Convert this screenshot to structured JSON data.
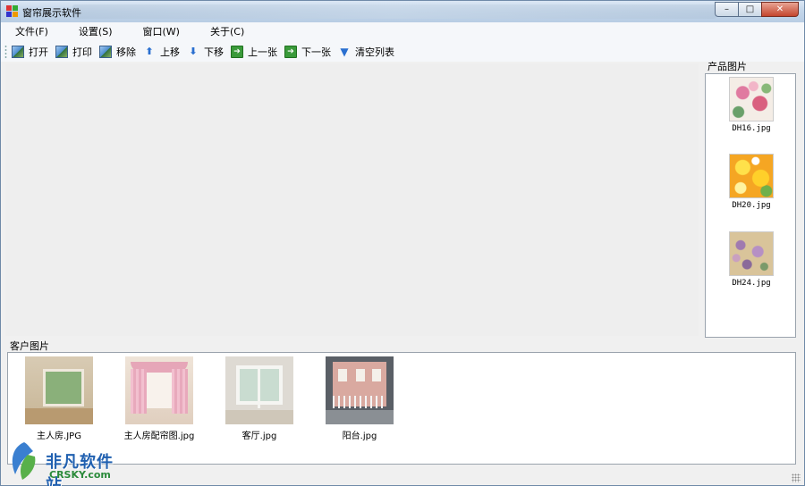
{
  "window": {
    "title": "窗帘展示软件",
    "buttons": {
      "minimize": "–",
      "maximize": "□",
      "close": "✕"
    }
  },
  "menu": [
    {
      "id": "file",
      "label": "文件(F)"
    },
    {
      "id": "settings",
      "label": "设置(S)"
    },
    {
      "id": "window",
      "label": "窗口(W)"
    },
    {
      "id": "about",
      "label": "关于(C)"
    }
  ],
  "toolbar": {
    "open": "打开",
    "print": "打印",
    "remove": "移除",
    "move_up": "上移",
    "move_down": "下移",
    "prev": "上一张",
    "next": "下一张",
    "clear": "清空列表"
  },
  "product_panel": {
    "label": "产品图片",
    "items": [
      {
        "name": "DH16.jpg",
        "swatch": "floral-pink"
      },
      {
        "name": "DH20.jpg",
        "swatch": "floral-yellow"
      },
      {
        "name": "DH24.jpg",
        "swatch": "floral-beige"
      }
    ]
  },
  "customer_panel": {
    "label": "客户图片",
    "items": [
      {
        "name": "主人房.JPG"
      },
      {
        "name": "主人房配帘图.jpg"
      },
      {
        "name": "客厅.jpg"
      },
      {
        "name": "阳台.jpg"
      }
    ]
  },
  "watermark": {
    "cn": "非凡软件站",
    "en": "CRSKY.com"
  },
  "colors": {
    "titlebar": "#c4d6ea",
    "workspace": "#eeeeee",
    "accent": "#2a6fd0"
  }
}
